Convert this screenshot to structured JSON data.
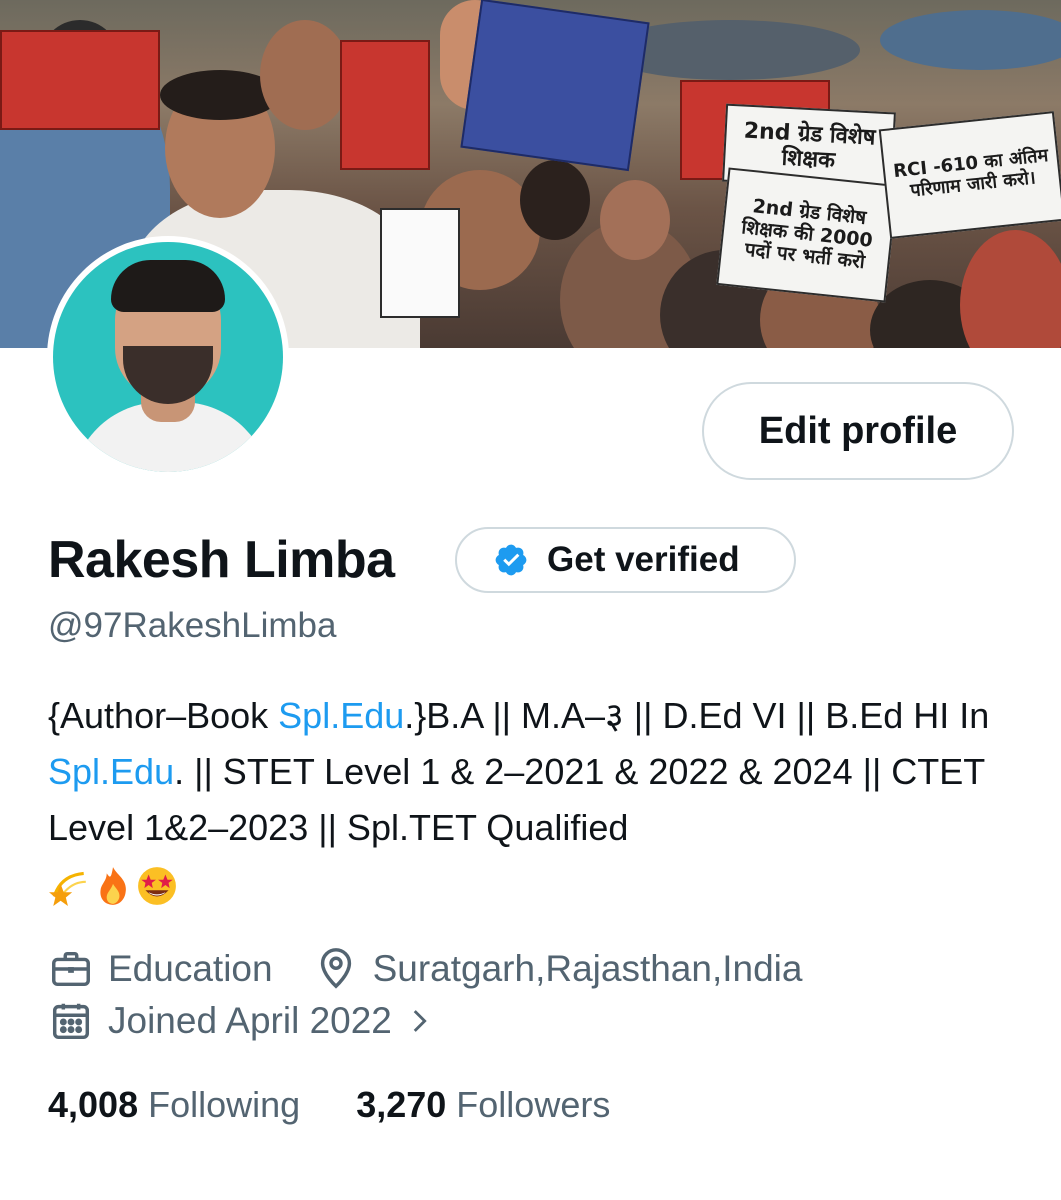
{
  "profile": {
    "name": "Rakesh Limba",
    "handle": "@97RakeshLimba",
    "get_verified_label": "Get verified",
    "edit_profile_label": "Edit profile",
    "bio": {
      "part1": "{Author–Book ",
      "link1": "Spl.Edu",
      "part2": ".}B.A || M.A–३ || D.Ed VI || B.Ed HI In ",
      "link2": "Spl.Edu",
      "part3": ". || STET Level 1 & 2–2021 & 2022 & 2024 || CTET Level 1&2–2023 || Spl.TET Qualified"
    },
    "category": "Education",
    "location": "Suratgarh,Rajasthan,India",
    "joined": "Joined April 2022",
    "following_count": "4,008",
    "following_label": "Following",
    "followers_count": "3,270",
    "followers_label": "Followers"
  },
  "banner": {
    "signs": [
      "2nd ग्रेड विशेष शिक्षक",
      "2nd ग्रेड विशेष शिक्षक की 2000 पदों पर भर्ती करो",
      "RCI -610 का अंतिम परिणाम जारी करो।"
    ]
  },
  "colors": {
    "link": "#1d9bf0",
    "secondary_text": "#536471",
    "border": "#cfd9de",
    "avatar_bg": "#2cc2bf"
  },
  "icons": [
    "briefcase-icon",
    "location-pin-icon",
    "calendar-icon",
    "chevron-right-icon",
    "verified-badge-icon"
  ]
}
